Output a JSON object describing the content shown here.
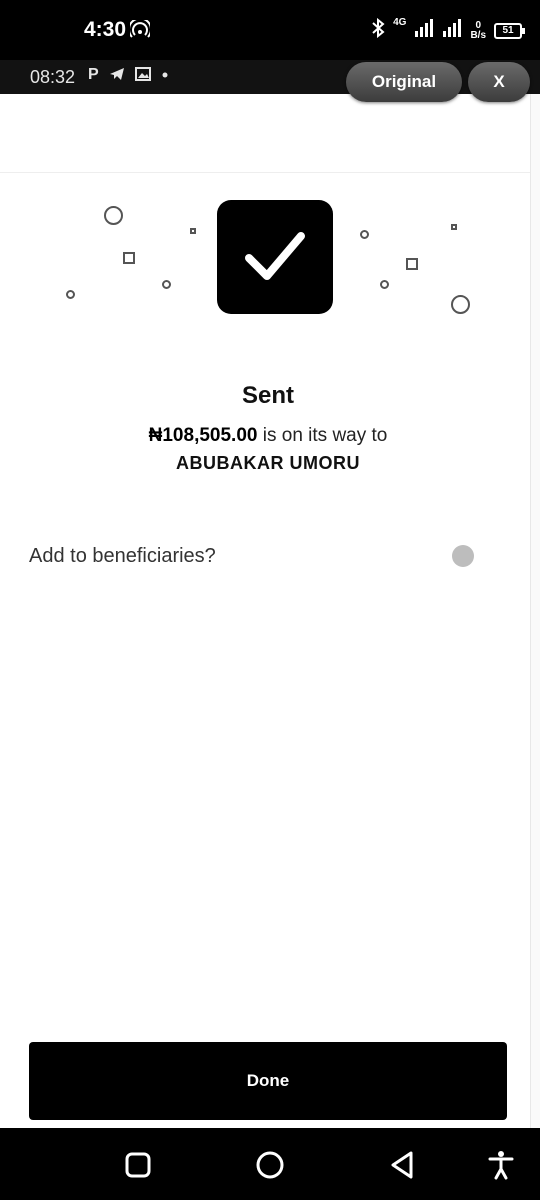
{
  "outer_status": {
    "time": "4:30",
    "network": "4G",
    "speed_value": "0",
    "speed_unit": "B/s",
    "battery": "51"
  },
  "inner_status": {
    "time": "08:32",
    "app_letter": "P"
  },
  "overlay": {
    "original_label": "Original",
    "close_label": "X"
  },
  "confirmation": {
    "title": "Sent",
    "amount": "₦108,505.00",
    "message": " is on its way to",
    "recipient": "ABUBAKAR  UMORU"
  },
  "beneficiary": {
    "label": "Add to beneficiaries?",
    "enabled": false
  },
  "actions": {
    "done_label": "Done"
  },
  "colors": {
    "primary": "#000000",
    "background": "#ffffff",
    "toggle_off": "#bdbdbd"
  }
}
